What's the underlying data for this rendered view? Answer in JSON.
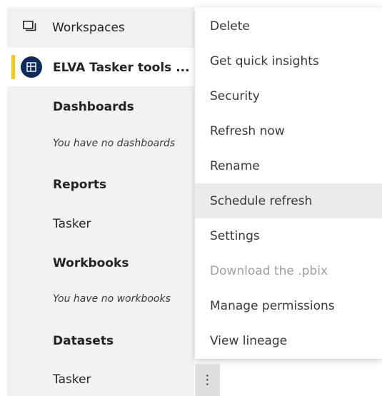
{
  "nav": {
    "workspaces_label": "Workspaces",
    "workspace_name": "ELVA Tasker tools ...",
    "sections": {
      "dashboards": {
        "title": "Dashboards",
        "empty": "You have no dashboards"
      },
      "reports": {
        "title": "Reports",
        "items": [
          "Tasker"
        ]
      },
      "workbooks": {
        "title": "Workbooks",
        "empty": "You have no workbooks"
      },
      "datasets": {
        "title": "Datasets",
        "items": [
          "Tasker"
        ]
      }
    }
  },
  "menu": {
    "items": [
      {
        "label": "Delete",
        "state": "normal"
      },
      {
        "label": "Get quick insights",
        "state": "normal"
      },
      {
        "label": "Security",
        "state": "normal"
      },
      {
        "label": "Refresh now",
        "state": "normal"
      },
      {
        "label": "Rename",
        "state": "normal"
      },
      {
        "label": "Schedule refresh",
        "state": "hover"
      },
      {
        "label": "Settings",
        "state": "normal"
      },
      {
        "label": "Download the .pbix",
        "state": "disabled"
      },
      {
        "label": "Manage permissions",
        "state": "normal"
      },
      {
        "label": "View lineage",
        "state": "normal"
      }
    ]
  },
  "more_options": {
    "glyph": "⋮"
  },
  "colors": {
    "accent": "#f2c811",
    "avatar": "#0f2b5b",
    "nav_bg": "#f3f2f1",
    "hover_bg": "#ebebeb"
  }
}
